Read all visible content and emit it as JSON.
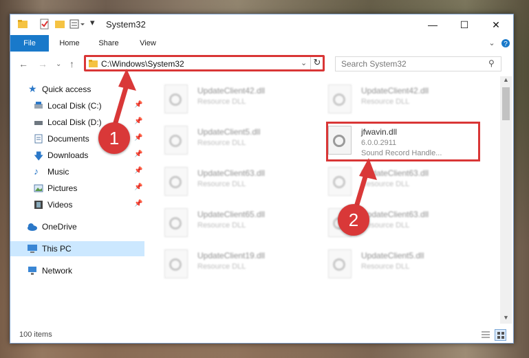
{
  "window": {
    "title": "System32"
  },
  "ribbon": {
    "tabs": [
      "File",
      "Home",
      "Share",
      "View"
    ]
  },
  "address": {
    "path": "C:\\Windows\\System32"
  },
  "search": {
    "placeholder": "Search System32"
  },
  "sidebar": {
    "items": [
      {
        "label": "Quick access",
        "icon": "star-icon",
        "pinned": false
      },
      {
        "label": "Local Disk (C:)",
        "icon": "drive-icon",
        "pinned": true
      },
      {
        "label": "Local Disk (D:)",
        "icon": "drive-icon",
        "pinned": true
      },
      {
        "label": "Documents",
        "icon": "documents-icon",
        "pinned": true
      },
      {
        "label": "Downloads",
        "icon": "download-icon",
        "pinned": true
      },
      {
        "label": "Music",
        "icon": "music-icon",
        "pinned": true
      },
      {
        "label": "Pictures",
        "icon": "pictures-icon",
        "pinned": true
      },
      {
        "label": "Videos",
        "icon": "videos-icon",
        "pinned": true
      },
      {
        "label": "OneDrive",
        "icon": "cloud-icon",
        "pinned": false
      },
      {
        "label": "This PC",
        "icon": "computer-icon",
        "pinned": false,
        "selected": true
      },
      {
        "label": "Network",
        "icon": "network-icon",
        "pinned": false
      }
    ]
  },
  "files": {
    "left": [
      {
        "name": "UpdateClient42.dll",
        "type": "Resource DLL"
      },
      {
        "name": "UpdateClient5.dll",
        "type": "Resource DLL"
      },
      {
        "name": "UpdateClient63.dll",
        "type": "Resource DLL"
      },
      {
        "name": "UpdateClient65.dll",
        "type": "Resource DLL"
      },
      {
        "name": "UpdateClient19.dll",
        "type": "Resource DLL"
      }
    ],
    "right": [
      {
        "name": "UpdateClient42.dll",
        "type": "Resource DLL"
      },
      {
        "name": "jfwavin.dll",
        "version": "6.0.0.2911",
        "type": "Sound Record Handle..."
      },
      {
        "name": "UpdateClient63.dll",
        "type": "Resource DLL"
      },
      {
        "name": "UpdateClient63.dll",
        "type": "Resource DLL"
      },
      {
        "name": "UpdateClient5.dll",
        "type": "Resource DLL"
      }
    ]
  },
  "status": {
    "count": "100 items"
  },
  "callouts": {
    "one": "1",
    "two": "2"
  },
  "colors": {
    "accent": "#1979ca",
    "highlight": "#d93636",
    "selected": "#cce8ff"
  }
}
